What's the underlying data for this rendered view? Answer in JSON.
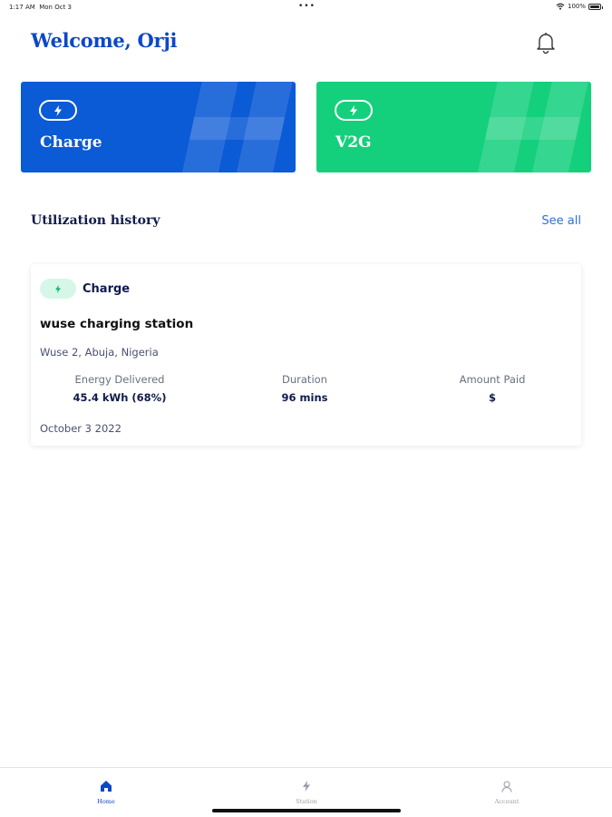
{
  "status_bar": {
    "time": "1:17 AM",
    "date": "Mon Oct 3",
    "dots": "•••",
    "battery": "100%",
    "battery_level": 1.0
  },
  "header": {
    "welcome": "Welcome, Orji"
  },
  "tiles": [
    {
      "label": "Charge",
      "color": "#0b5ad6"
    },
    {
      "label": "V2G",
      "color": "#14d07d"
    }
  ],
  "history": {
    "title": "Utilization history",
    "see_all": "See all",
    "items": [
      {
        "type": "Charge",
        "station": "wuse charging station",
        "address": "Wuse 2, Abuja, Nigeria",
        "energy_label": "Energy Delivered",
        "energy_value": "45.4 kWh (68%)",
        "duration_label": "Duration",
        "duration_value": "96 mins",
        "amount_label": "Amount Paid",
        "amount_value": "$",
        "date": "October 3 2022"
      }
    ]
  },
  "tab_bar": {
    "items": [
      {
        "label": "Home",
        "icon": "home-icon",
        "active": true
      },
      {
        "label": "Station",
        "icon": "station-icon",
        "active": false
      },
      {
        "label": "Account",
        "icon": "account-icon",
        "active": false
      }
    ]
  },
  "colors": {
    "brand_blue": "#0d47c9",
    "charge_blue": "#0b5ad6",
    "v2g_green": "#14d07d",
    "link": "#2f6fd6"
  }
}
